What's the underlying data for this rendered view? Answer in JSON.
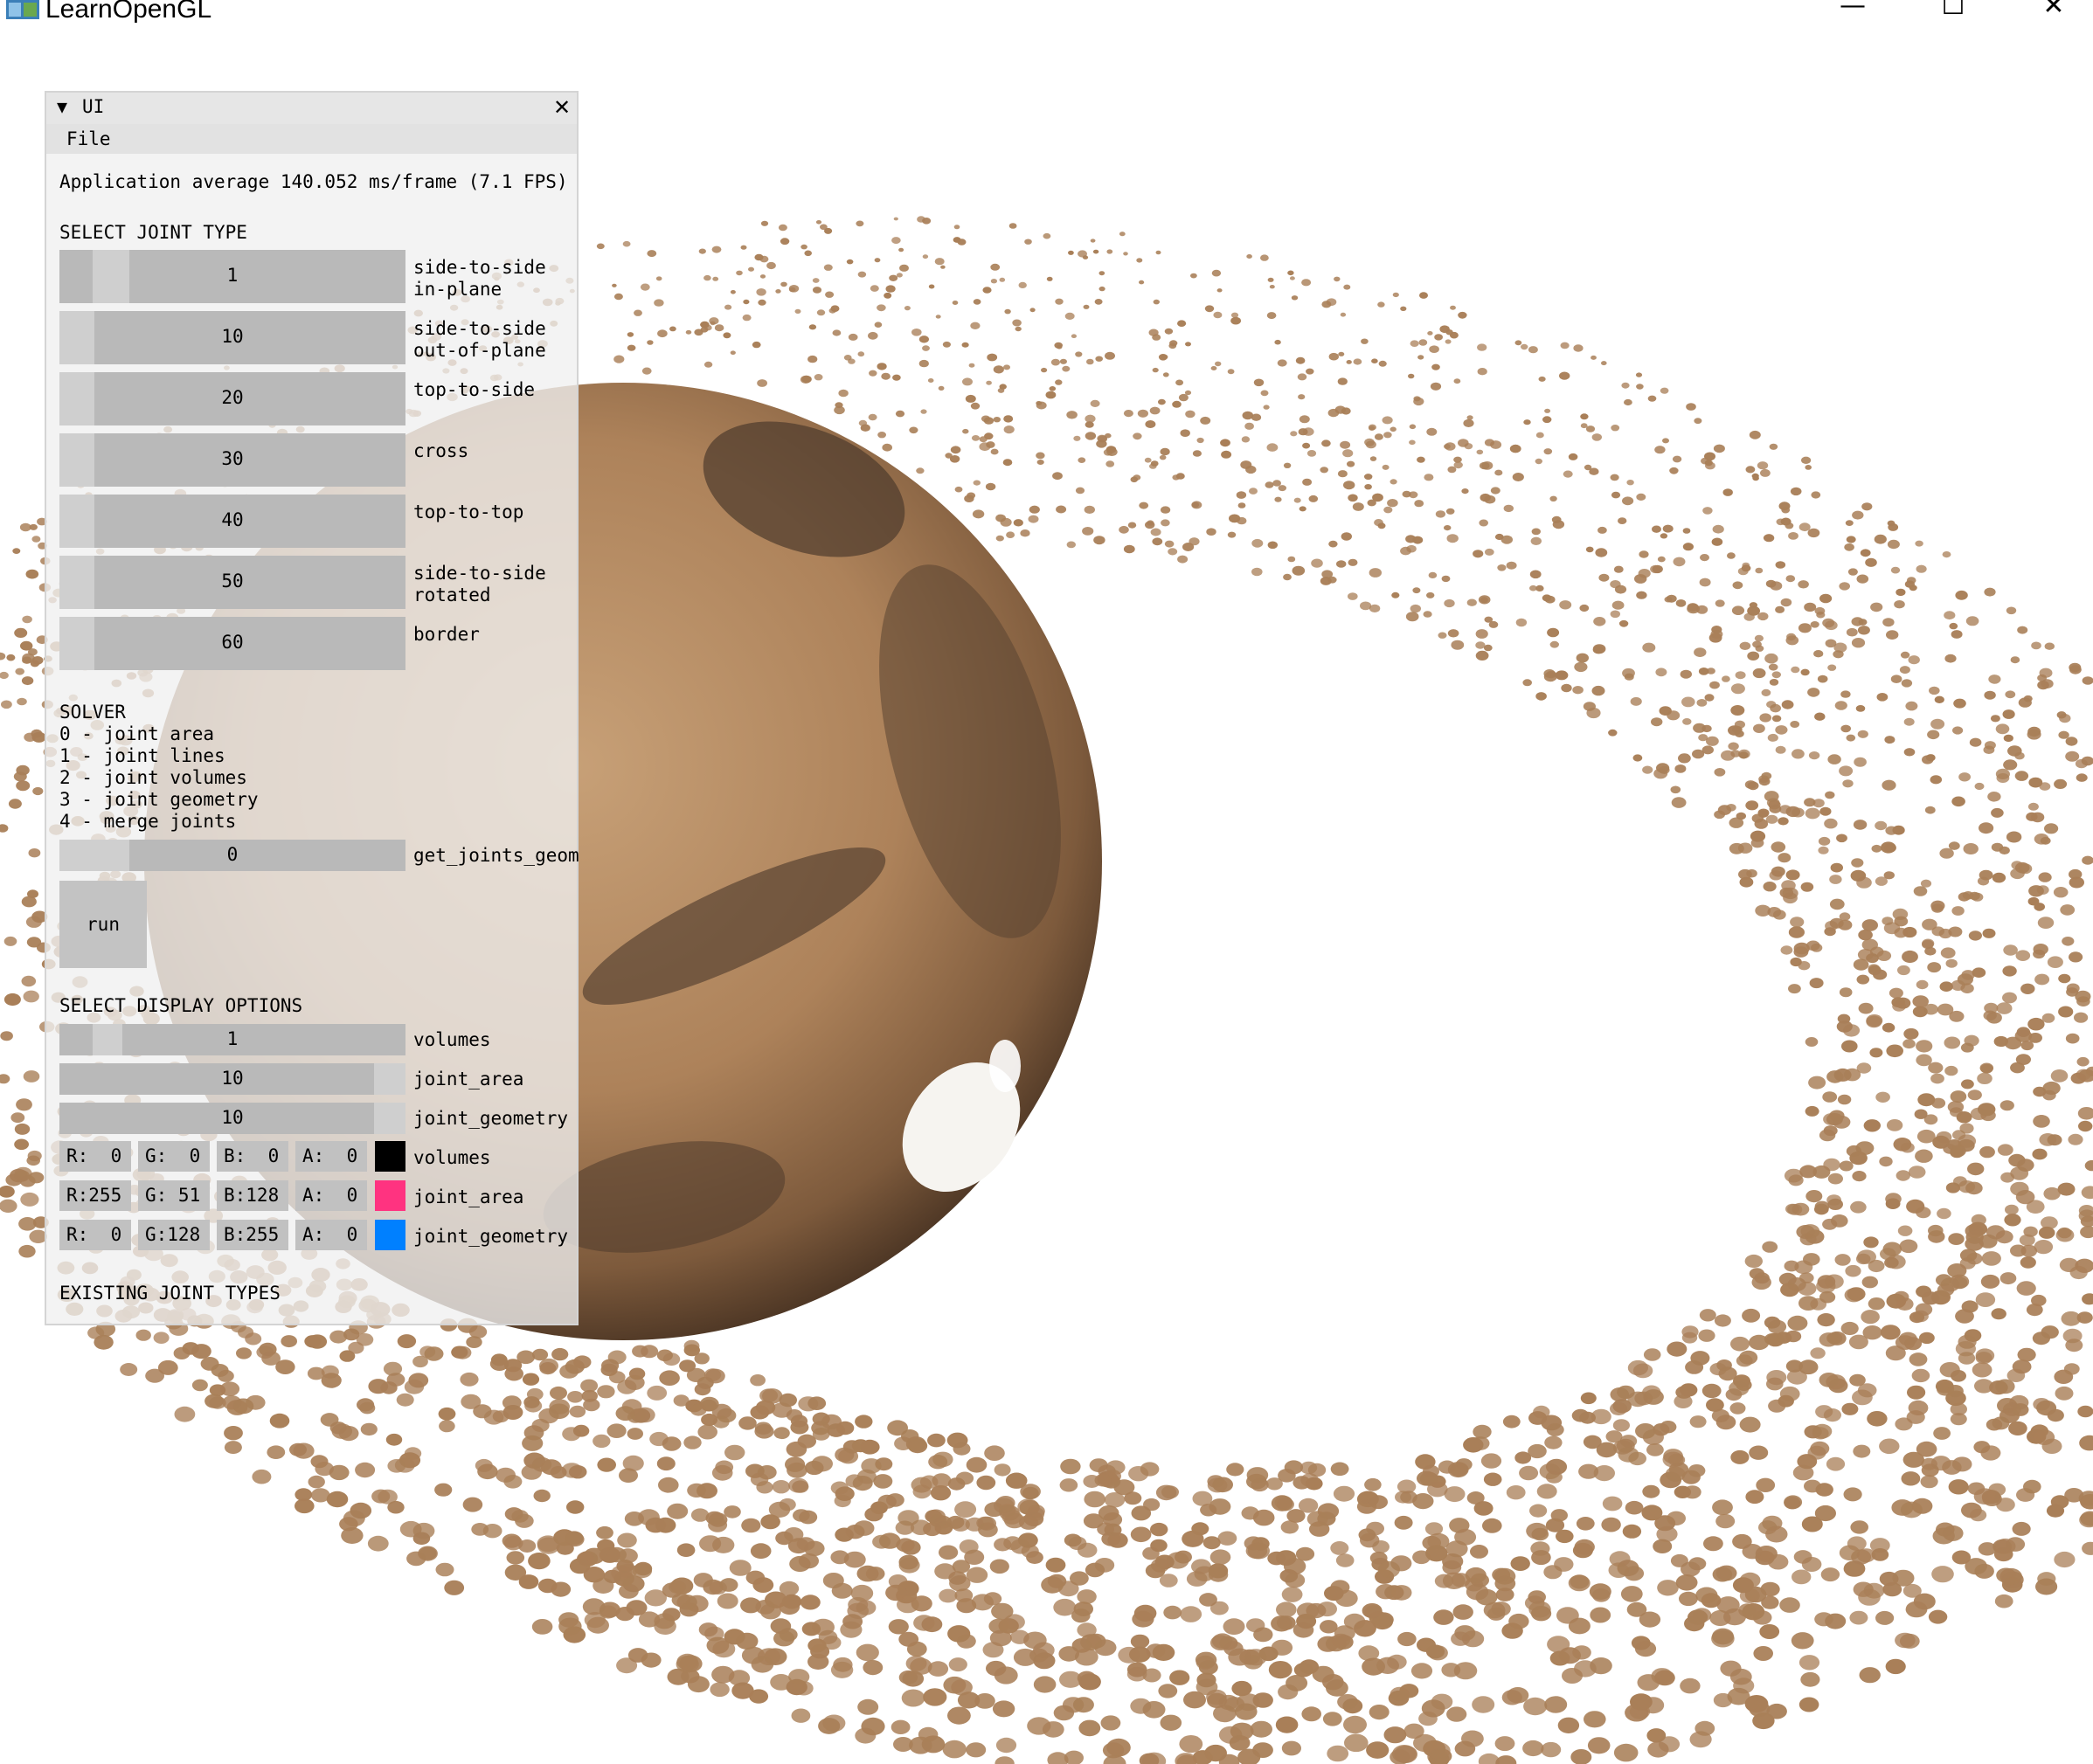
{
  "window": {
    "title": "LearnOpenGL",
    "controls": {
      "minimize": "—",
      "maximize": "☐",
      "close": "✕"
    }
  },
  "panel": {
    "title": "UI",
    "collapse_icon": "▼",
    "close_icon": "✕",
    "menu": {
      "file": "File"
    },
    "fps_text": "Application average 140.052 ms/frame (7.1 FPS)",
    "joint_type_heading": "SELECT JOINT TYPE",
    "joint_types": [
      {
        "value": "1",
        "label": "side-to-side\nin-plane"
      },
      {
        "value": "10",
        "label": "side-to-side\nout-of-plane"
      },
      {
        "value": "20",
        "label": "top-to-side"
      },
      {
        "value": "30",
        "label": "cross"
      },
      {
        "value": "40",
        "label": "top-to-top"
      },
      {
        "value": "50",
        "label": "side-to-side\nrotated"
      },
      {
        "value": "60",
        "label": "border"
      }
    ],
    "solver": {
      "heading": "SOLVER",
      "options": [
        "0 - joint area",
        "1 - joint lines",
        "2 - joint volumes",
        "3 - joint geometry",
        "4 - merge joints"
      ],
      "value": "0",
      "label": "get_joints_geom",
      "run_label": "run"
    },
    "display_heading": "SELECT DISPLAY OPTIONS",
    "display_sliders": [
      {
        "value": "1",
        "label": "volumes"
      },
      {
        "value": "10",
        "label": "joint_area"
      },
      {
        "value": "10",
        "label": "joint_geometry"
      }
    ],
    "colors": [
      {
        "r": "R:  0",
        "g": "G:  0",
        "b": "B:  0",
        "a": "A:  0",
        "swatch": "#000000",
        "label": "volumes"
      },
      {
        "r": "R:255",
        "g": "G: 51",
        "b": "B:128",
        "a": "A:  0",
        "swatch": "#ff3380",
        "label": "joint_area"
      },
      {
        "r": "R:  0",
        "g": "G:128",
        "b": "B:255",
        "a": "A:  0",
        "swatch": "#0080ff",
        "label": "joint_geometry"
      }
    ],
    "existing_heading": "EXISTING JOINT TYPES"
  },
  "scene": {
    "planet": "mars",
    "ring_color": "#a97f58",
    "planet_color": "#b38a62"
  }
}
